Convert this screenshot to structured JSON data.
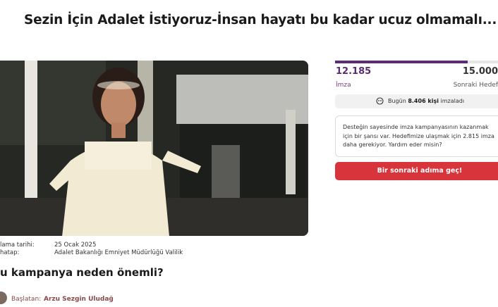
{
  "page": {
    "title": "Sezin İçin Adalet İstiyoruz-İnsan hayatı bu kadar ucuz olmamalı..."
  },
  "meta": {
    "date_label": "lama tarihi:",
    "date_value": "25 Ocak 2025",
    "recipient_label": "hatap:",
    "recipient_value": "Adalet Bakanlığı Emniyet Müdürlüğü Valilik"
  },
  "why_heading": "u kampanya neden önemli?",
  "starter": {
    "prefix": "Başlatan:",
    "name": "Arzu Sezgin Uludağ"
  },
  "signatures": {
    "count": "12.185",
    "count_label": "İmza",
    "goal": "15.000",
    "goal_label": "Sonraki Hedef",
    "progress_fraction": 0.812
  },
  "today": {
    "prefix": "Bugün",
    "count": "8.406 kişi",
    "suffix": "imzaladı"
  },
  "support_text": "Desteğin sayesinde imza kampanyasının kazanmak için bir şansı var. Hedefimize ulaşmak için 2.815 imza daha gerekiyor. Yardım eder misin?",
  "cta_label": "Bir sonraki adıma geç!",
  "colors": {
    "accent_purple": "#5b2c6f",
    "cta_red": "#d8343b"
  }
}
